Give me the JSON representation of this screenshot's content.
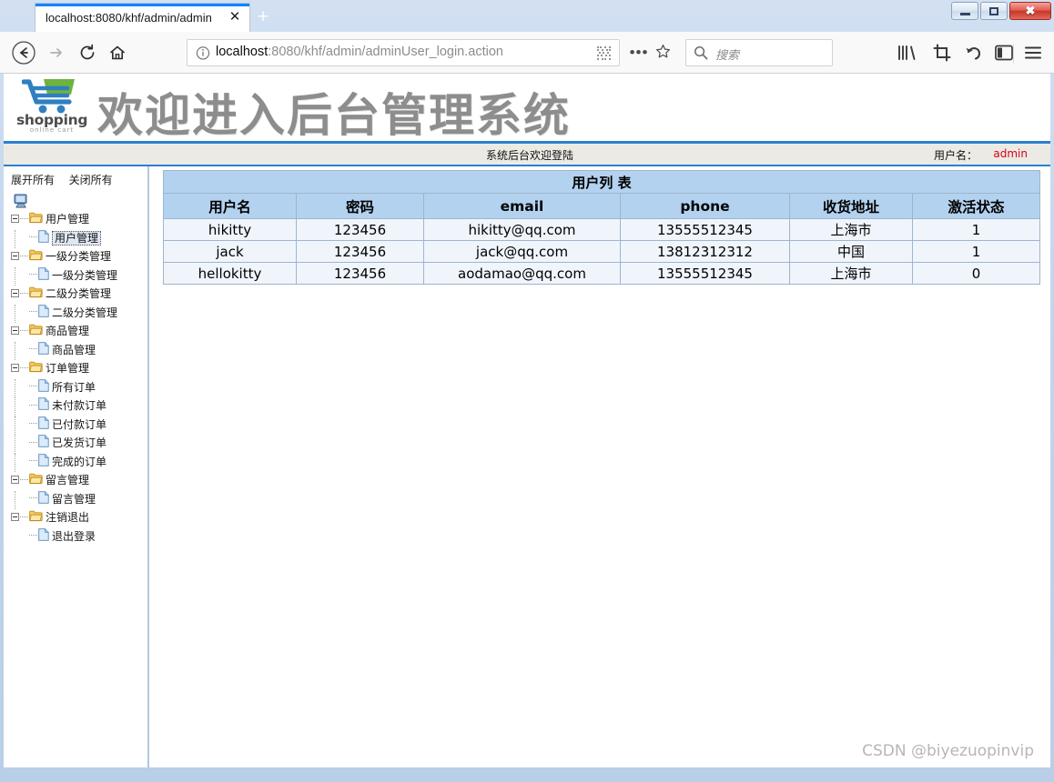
{
  "browser": {
    "tab": {
      "title": "localhost:8080/khf/admin/admin",
      "close_icon": "close-icon",
      "new_tab_icon": "plus-icon"
    },
    "window_controls": {
      "minimize": "minimize-icon",
      "maximize": "maximize-icon",
      "close": "x-icon"
    },
    "nav": {
      "back_icon": "back-arrow-icon",
      "forward_icon": "forward-arrow-icon",
      "reload_icon": "reload-icon",
      "home_icon": "home-icon",
      "ellipsis": "•••",
      "star_icon": "star-icon",
      "library_icon": "library-icon",
      "screenshot_icon": "screenshot-icon",
      "undo_icon": "undo-icon",
      "sidebar_icon": "sidebar-icon",
      "menu_icon": "hamburger-menu-icon"
    },
    "url": {
      "info_icon": "info-icon",
      "host": "localhost",
      "path": ":8080/khf/admin/adminUser_login.action",
      "full": "localhost:8080/khf/admin/adminUser_login.action",
      "qr_icon": "qr-code-icon"
    },
    "search": {
      "icon": "search-icon",
      "placeholder": "搜索",
      "value": ""
    }
  },
  "banner": {
    "logo": {
      "word": "shopping",
      "sub": "online cart",
      "icon": "shopping-cart-icon",
      "cart_color": "#2f7fc1",
      "basket_color": "#6db33f"
    },
    "title": "欢迎进入后台管理系统",
    "accent_color": "#2b7fd0"
  },
  "welcome": {
    "text": "系统后台欢迎登陆",
    "user_label": "用户名：",
    "user_value": "admin",
    "user_value_color": "#d4001a"
  },
  "sidebar": {
    "expand_all": "展开所有",
    "collapse_all": "关闭所有",
    "root_icon": "computer-icon",
    "tree": [
      {
        "label": "用户管理",
        "icon": "folder-icon",
        "children": [
          {
            "label": "用户管理",
            "icon": "file-icon",
            "selected": true
          }
        ]
      },
      {
        "label": "一级分类管理",
        "icon": "folder-icon",
        "children": [
          {
            "label": "一级分类管理",
            "icon": "file-icon",
            "selected": false
          }
        ]
      },
      {
        "label": "二级分类管理",
        "icon": "folder-icon",
        "children": [
          {
            "label": "二级分类管理",
            "icon": "file-icon",
            "selected": false
          }
        ]
      },
      {
        "label": "商品管理",
        "icon": "folder-icon",
        "children": [
          {
            "label": "商品管理",
            "icon": "file-icon",
            "selected": false
          }
        ]
      },
      {
        "label": "订单管理",
        "icon": "folder-icon",
        "children": [
          {
            "label": "所有订单",
            "icon": "file-icon",
            "selected": false
          },
          {
            "label": "未付款订单",
            "icon": "file-icon",
            "selected": false
          },
          {
            "label": "已付款订单",
            "icon": "file-icon",
            "selected": false
          },
          {
            "label": "已发货订单",
            "icon": "file-icon",
            "selected": false
          },
          {
            "label": "完成的订单",
            "icon": "file-icon",
            "selected": false
          }
        ]
      },
      {
        "label": "留言管理",
        "icon": "folder-icon",
        "children": [
          {
            "label": "留言管理",
            "icon": "file-icon",
            "selected": false
          }
        ]
      },
      {
        "label": "注销退出",
        "icon": "folder-icon",
        "children": [
          {
            "label": "退出登录",
            "icon": "file-icon",
            "selected": false
          }
        ]
      }
    ]
  },
  "main": {
    "table_title": "用户列 表",
    "columns": [
      "用户名",
      "密码",
      "email",
      "phone",
      "收货地址",
      "激活状态"
    ],
    "rows": [
      [
        "hikitty",
        "123456",
        "hikitty@qq.com",
        "13555512345",
        "上海市",
        "1"
      ],
      [
        "jack",
        "123456",
        "jack@qq.com",
        "13812312312",
        "中国",
        "1"
      ],
      [
        "hellokitty",
        "123456",
        "aodamao@qq.com",
        "13555512345",
        "上海市",
        "0"
      ]
    ],
    "header_bg": "#b3d2ef",
    "row_bg": "#f0f5fc"
  },
  "watermark": "CSDN @biyezuopinvip"
}
